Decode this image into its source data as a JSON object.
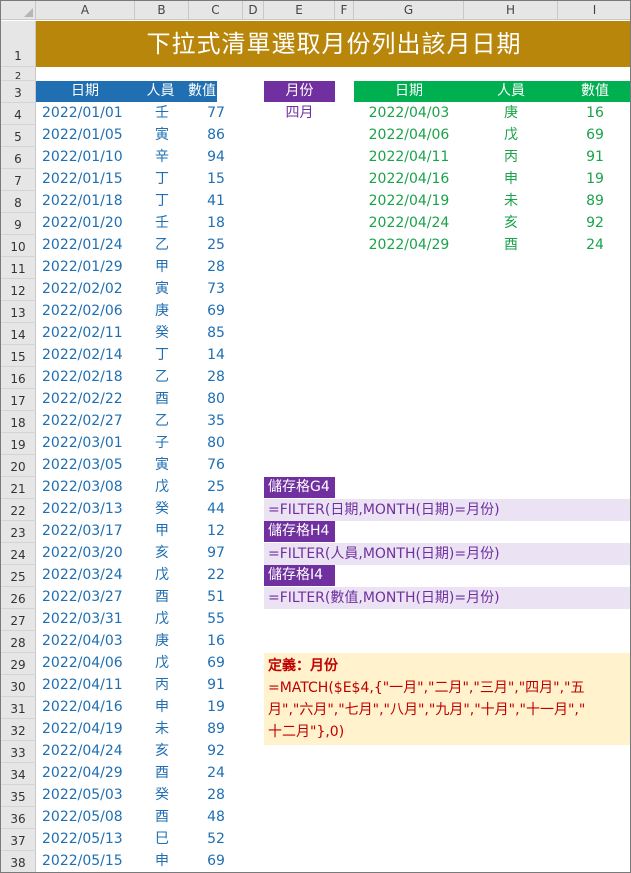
{
  "sheet": {
    "title": "下拉式清單選取月份列出該月日期",
    "columns": [
      "A",
      "B",
      "C",
      "D",
      "E",
      "F",
      "G",
      "H",
      "I"
    ],
    "rows": [
      "1",
      "2",
      "3",
      "4",
      "5",
      "6",
      "7",
      "8",
      "9",
      "10",
      "11",
      "12",
      "13",
      "14",
      "15",
      "16",
      "17",
      "18",
      "19",
      "20",
      "21",
      "22",
      "23",
      "24",
      "25",
      "26",
      "27",
      "28",
      "29",
      "30",
      "31",
      "32",
      "33",
      "34",
      "35",
      "36",
      "37",
      "38"
    ]
  },
  "source_table": {
    "headers": {
      "date": "日期",
      "person": "人員",
      "value": "數值"
    },
    "rows": [
      [
        "2022/01/01",
        "壬",
        "77"
      ],
      [
        "2022/01/05",
        "寅",
        "86"
      ],
      [
        "2022/01/10",
        "辛",
        "94"
      ],
      [
        "2022/01/15",
        "丁",
        "15"
      ],
      [
        "2022/01/18",
        "丁",
        "41"
      ],
      [
        "2022/01/20",
        "壬",
        "18"
      ],
      [
        "2022/01/24",
        "乙",
        "25"
      ],
      [
        "2022/01/29",
        "甲",
        "28"
      ],
      [
        "2022/02/02",
        "寅",
        "73"
      ],
      [
        "2022/02/06",
        "庚",
        "69"
      ],
      [
        "2022/02/11",
        "癸",
        "85"
      ],
      [
        "2022/02/14",
        "丁",
        "14"
      ],
      [
        "2022/02/18",
        "乙",
        "28"
      ],
      [
        "2022/02/22",
        "酉",
        "80"
      ],
      [
        "2022/02/27",
        "乙",
        "35"
      ],
      [
        "2022/03/01",
        "子",
        "80"
      ],
      [
        "2022/03/05",
        "寅",
        "76"
      ],
      [
        "2022/03/08",
        "戊",
        "25"
      ],
      [
        "2022/03/13",
        "癸",
        "44"
      ],
      [
        "2022/03/17",
        "甲",
        "12"
      ],
      [
        "2022/03/20",
        "亥",
        "97"
      ],
      [
        "2022/03/24",
        "戊",
        "22"
      ],
      [
        "2022/03/27",
        "酉",
        "51"
      ],
      [
        "2022/03/31",
        "戊",
        "55"
      ],
      [
        "2022/04/03",
        "庚",
        "16"
      ],
      [
        "2022/04/06",
        "戊",
        "69"
      ],
      [
        "2022/04/11",
        "丙",
        "91"
      ],
      [
        "2022/04/16",
        "申",
        "19"
      ],
      [
        "2022/04/19",
        "未",
        "89"
      ],
      [
        "2022/04/24",
        "亥",
        "92"
      ],
      [
        "2022/04/29",
        "酉",
        "24"
      ],
      [
        "2022/05/03",
        "癸",
        "28"
      ],
      [
        "2022/05/08",
        "酉",
        "48"
      ],
      [
        "2022/05/13",
        "巳",
        "52"
      ],
      [
        "2022/05/15",
        "申",
        "69"
      ]
    ]
  },
  "month_selector": {
    "header": "月份",
    "value": "四月"
  },
  "result_table": {
    "headers": {
      "date": "日期",
      "person": "人員",
      "value": "數值"
    },
    "rows": [
      [
        "2022/04/03",
        "庚",
        "16"
      ],
      [
        "2022/04/06",
        "戊",
        "69"
      ],
      [
        "2022/04/11",
        "丙",
        "91"
      ],
      [
        "2022/04/16",
        "申",
        "19"
      ],
      [
        "2022/04/19",
        "未",
        "89"
      ],
      [
        "2022/04/24",
        "亥",
        "92"
      ],
      [
        "2022/04/29",
        "酉",
        "24"
      ]
    ]
  },
  "formulas": [
    {
      "label": "儲存格G4",
      "formula": "=FILTER(日期,MONTH(日期)=月份)"
    },
    {
      "label": "儲存格H4",
      "formula": "=FILTER(人員,MONTH(日期)=月份)"
    },
    {
      "label": "儲存格I4",
      "formula": "=FILTER(數值,MONTH(日期)=月份)"
    }
  ],
  "definition": {
    "title": "定義：月份",
    "lines": [
      "=MATCH($E$4,{\"一月\",\"二月\",\"三月\",\"四月\",\"五",
      "月\",\"六月\",\"七月\",\"八月\",\"九月\",\"十月\",\"十一月\",\"",
      "十二月\"},0)"
    ]
  },
  "colors": {
    "title_bg": "#b8860b",
    "blue_header": "#1f6fb2",
    "purple_header": "#7030a0",
    "green_header": "#00b050",
    "formula_bg": "#ebe3f3",
    "definition_bg": "#fff2cc",
    "definition_text": "#c00000"
  }
}
